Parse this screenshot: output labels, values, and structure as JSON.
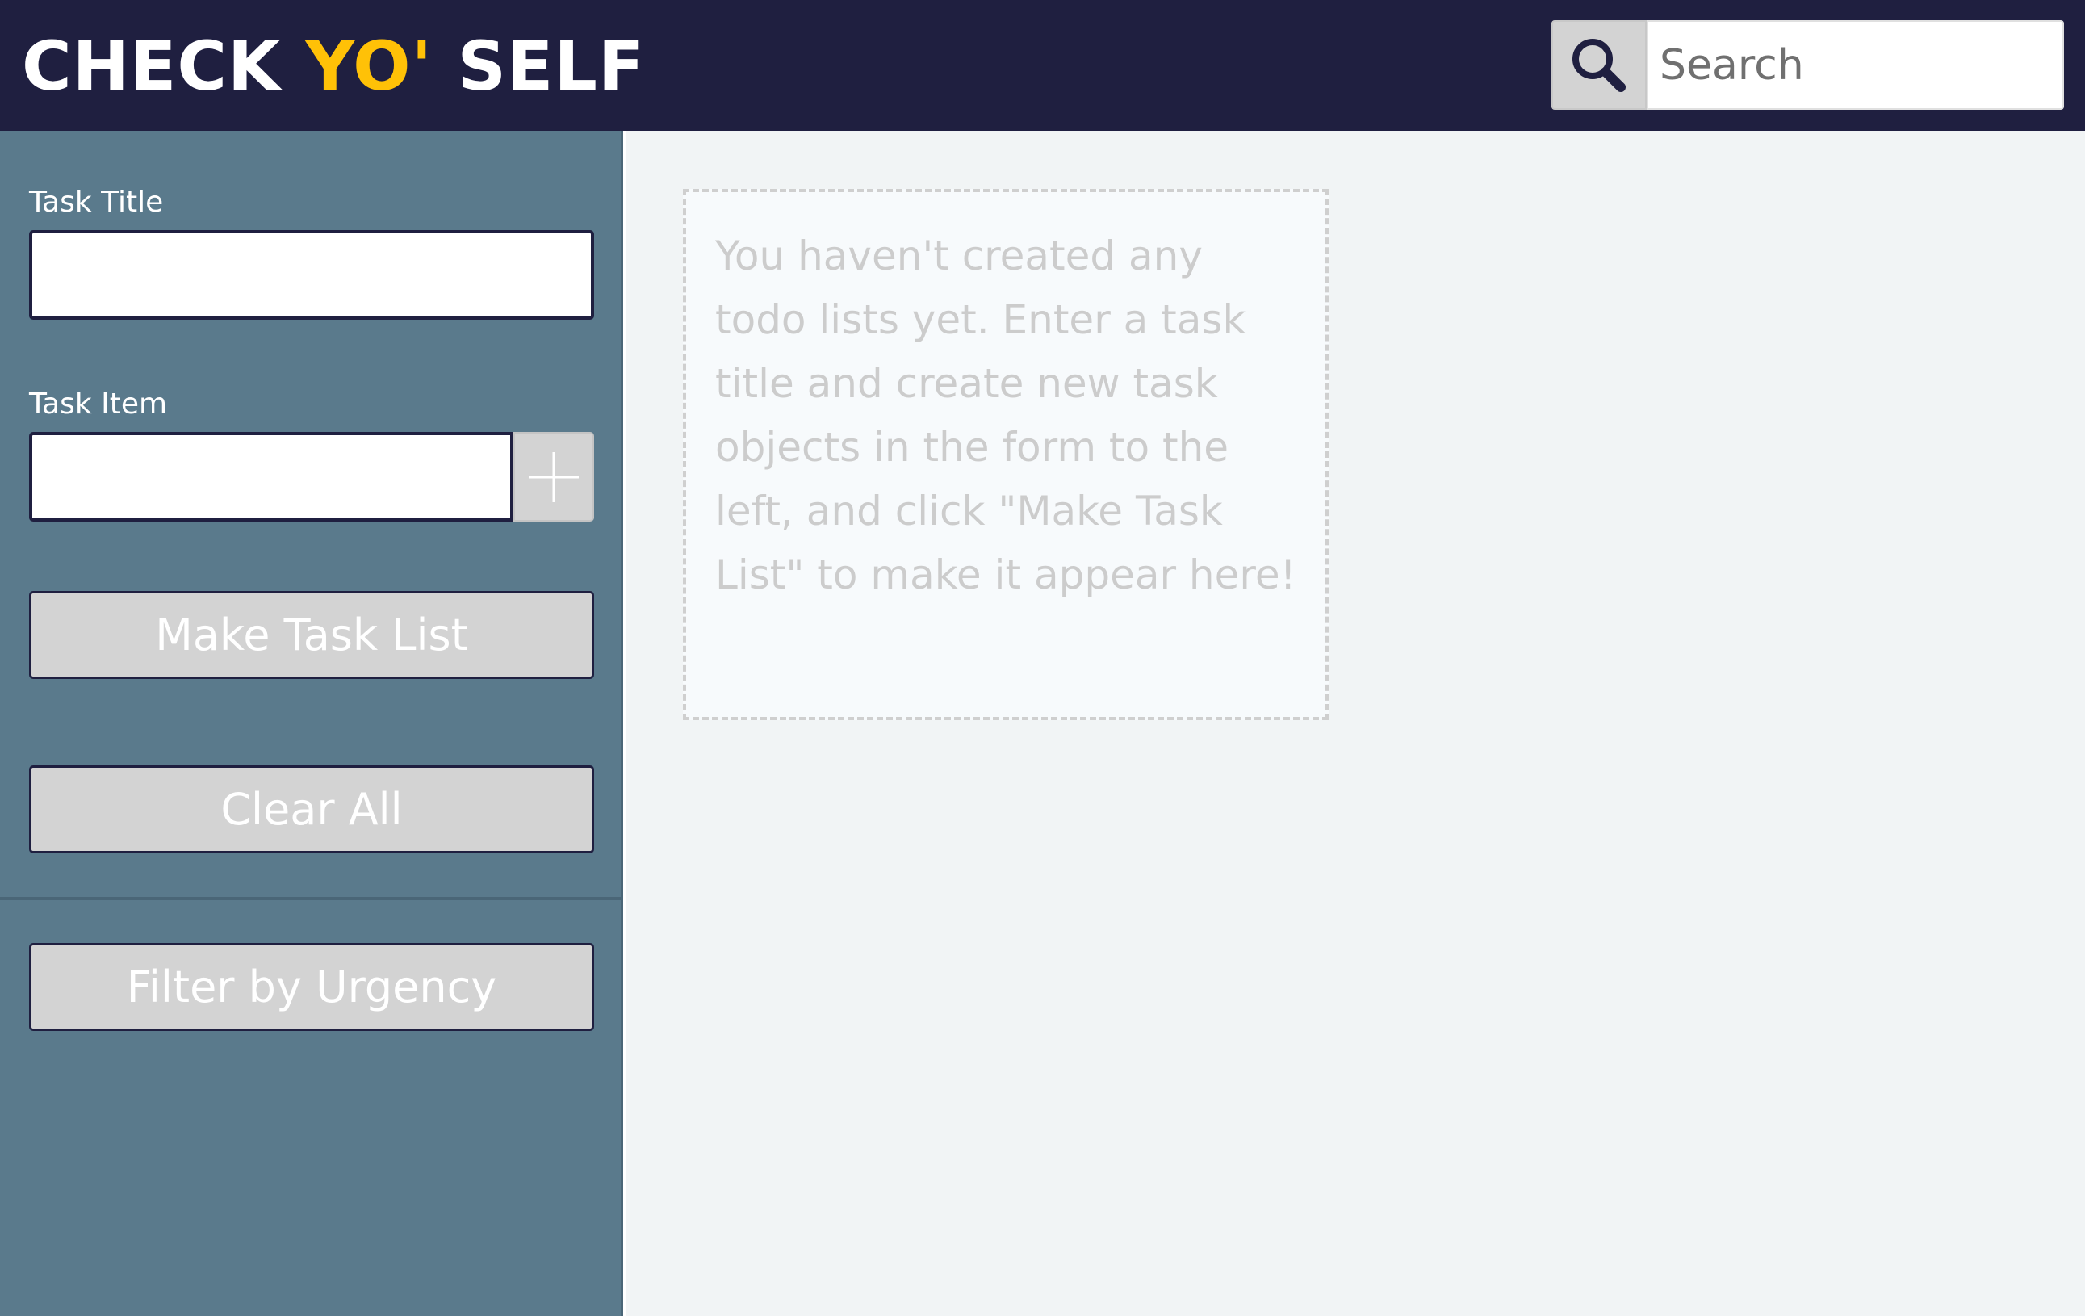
{
  "header": {
    "logo_part1": "CHECK ",
    "logo_part2": "YO'",
    "logo_part3": " SELF",
    "logo_accent_color": "#ffc107",
    "search": {
      "icon": "search-icon",
      "placeholder": "Search",
      "value": ""
    }
  },
  "sidebar": {
    "task_title_label": "Task Title",
    "task_title_value": "",
    "task_item_label": "Task Item",
    "task_item_value": "",
    "add_item_icon": "plus-icon",
    "make_task_list_label": "Make Task List",
    "clear_all_label": "Clear All",
    "filter_by_urgency_label": "Filter by Urgency"
  },
  "main": {
    "empty_message": "You haven't created any todo lists yet. Enter a task title and create new task objects in the form to the left, and click \"Make Task List\" to make it appear here!"
  },
  "colors": {
    "header_bg": "#1f1f40",
    "sidebar_bg": "#5a7a8c",
    "main_bg": "#f1f4f5",
    "button_bg": "#d3d3d3"
  }
}
